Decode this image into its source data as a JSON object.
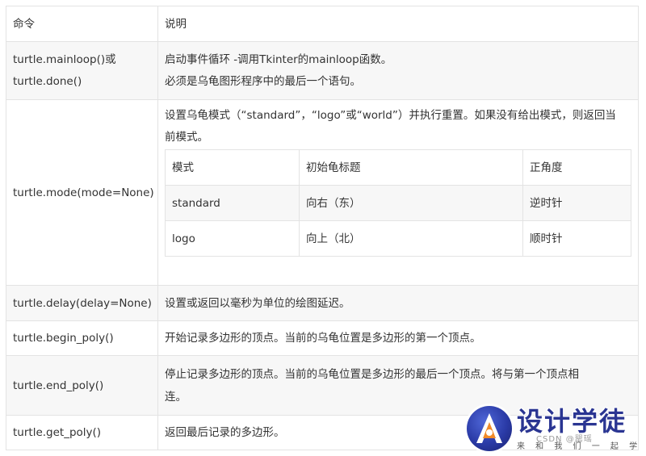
{
  "table": {
    "header": {
      "command": "命令",
      "description": "说明"
    },
    "rows": [
      {
        "command_lines": [
          "turtle.mainloop()或",
          "turtle.done()"
        ],
        "desc_lines": [
          "启动事件循环 -调用Tkinter的mainloop函数。",
          "必须是乌龟图形程序中的最后一个语句。"
        ]
      },
      {
        "command": "turtle.mode(mode=None)",
        "desc_lines": [
          "设置乌龟模式（“standard”，“logo”或“world”）并执行重置。如果没有给出模式，则返回当",
          "前模式。"
        ],
        "inner_table": {
          "header": [
            "模式",
            "初始龟标题",
            "正角度"
          ],
          "rows": [
            [
              "standard",
              "向右（东）",
              "逆时针"
            ],
            [
              "logo",
              "向上（北）",
              "顺时针"
            ]
          ]
        }
      },
      {
        "command": "turtle.delay(delay=None)",
        "desc": "设置或返回以毫秒为单位的绘图延迟。"
      },
      {
        "command": "turtle.begin_poly()",
        "desc": "开始记录多边形的顶点。当前的乌龟位置是多边形的第一个顶点。"
      },
      {
        "command": "turtle.end_poly()",
        "desc_lines": [
          "停止记录多边形的顶点。当前的乌龟位置是多边形的最后一个顶点。将与第一个顶点相",
          "连。"
        ]
      },
      {
        "command": "turtle.get_poly()",
        "desc": "返回最后记录的多边形。"
      }
    ]
  },
  "watermark": {
    "title": "设计学徒",
    "subtitle": "来 和 我 们 一 起 学 设 计",
    "credit": "CSDN @罂瑶"
  }
}
